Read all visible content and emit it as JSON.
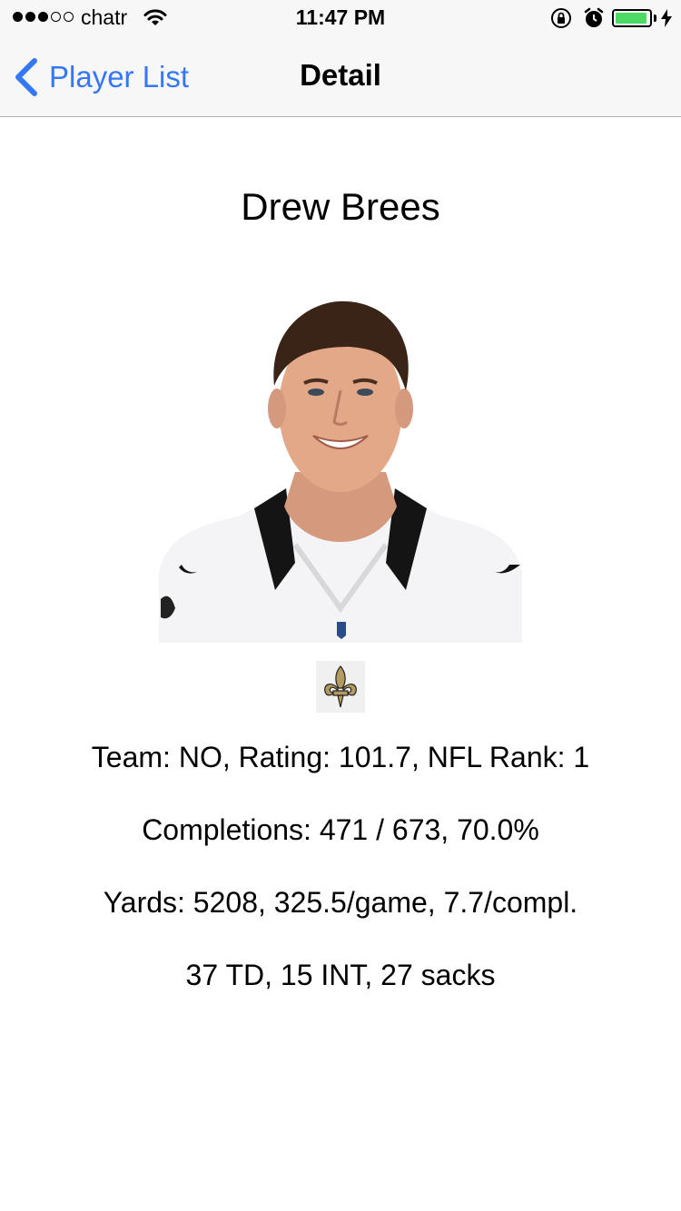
{
  "status_bar": {
    "carrier": "chatr",
    "time": "11:47 PM",
    "signal_filled": 3,
    "signal_total": 5,
    "battery_level": 0.95
  },
  "nav": {
    "back_label": "Player List",
    "title": "Detail"
  },
  "player": {
    "name": "Drew Brees",
    "photo_icon": "player-headshot",
    "team_logo_icon": "fleur-de-lis-icon"
  },
  "stats": {
    "line1": "Team: NO, Rating: 101.7, NFL Rank: 1",
    "line2": "Completions: 471 / 673, 70.0%",
    "line3": "Yards: 5208, 325.5/game, 7.7/compl.",
    "line4": "37 TD, 15 INT, 27 sacks"
  },
  "colors": {
    "accent": "#3478f6",
    "battery": "#4cd964",
    "saints_gold": "#b39a5f",
    "jersey_black": "#101010"
  }
}
